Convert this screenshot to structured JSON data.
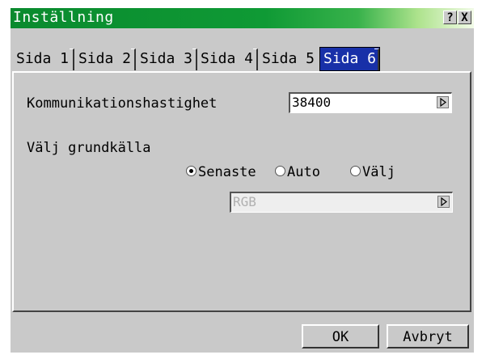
{
  "window": {
    "title": "Inställning",
    "help_label": "?",
    "close_label": "X"
  },
  "tabs": [
    {
      "label": "Sida 1"
    },
    {
      "label": "Sida 2"
    },
    {
      "label": "Sida 3"
    },
    {
      "label": "Sida 4"
    },
    {
      "label": "Sida 5"
    },
    {
      "label": "Sida 6",
      "active": true
    }
  ],
  "settings": {
    "comm_speed_label": "Kommunikationshastighet",
    "comm_speed_value": "38400",
    "default_source_label": "Välj grundkälla",
    "radio_options": [
      {
        "label": "Senaste",
        "checked": true
      },
      {
        "label": "Auto",
        "checked": false
      },
      {
        "label": "Välj",
        "checked": false
      }
    ],
    "source_value": "RGB"
  },
  "buttons": {
    "ok_label": "OK",
    "cancel_label": "Avbryt"
  },
  "colors": {
    "title_green": "#0a8a2e",
    "active_tab": "#1830a8",
    "dialog_gray": "#c9c9c9"
  }
}
